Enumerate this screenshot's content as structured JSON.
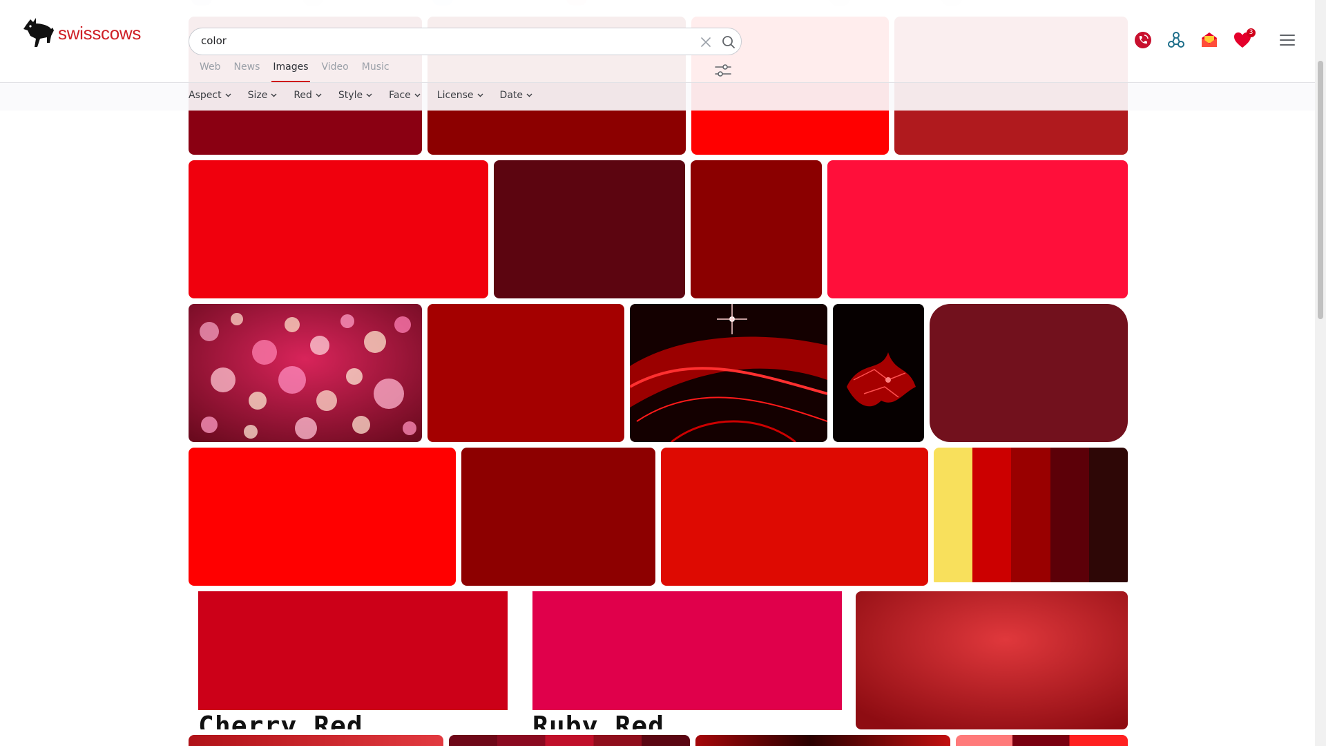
{
  "brand": {
    "name": "swisscows",
    "color": "#cf2027"
  },
  "search": {
    "value": "color",
    "placeholder": ""
  },
  "tabs": [
    {
      "label": "Web",
      "active": false
    },
    {
      "label": "News",
      "active": false
    },
    {
      "label": "Images",
      "active": true
    },
    {
      "label": "Video",
      "active": false
    },
    {
      "label": "Music",
      "active": false
    }
  ],
  "filters": [
    {
      "label": "Aspect"
    },
    {
      "label": "Size"
    },
    {
      "label": "Red"
    },
    {
      "label": "Style"
    },
    {
      "label": "Face"
    },
    {
      "label": "License"
    },
    {
      "label": "Date"
    }
  ],
  "header_icons": [
    {
      "name": "vpn-phone-icon",
      "color": "#c8102e"
    },
    {
      "name": "network-nodes-icon",
      "color": "#1f6f8b"
    },
    {
      "name": "mail-icon",
      "color": "#e4002b"
    },
    {
      "name": "favorites-heart-icon",
      "color": "#e4002b",
      "badge": "3"
    }
  ],
  "colors": {
    "accent": "#d0021b"
  },
  "images": [
    {
      "name": "image-dark-red-1",
      "fill": "#8a0012"
    },
    {
      "name": "image-dark-red-2",
      "fill": "#8c0000"
    },
    {
      "name": "image-bright-red-1",
      "fill": "#ff0000"
    },
    {
      "name": "image-brick-red-1",
      "fill": "#b01a1e"
    },
    {
      "name": "image-red-2",
      "fill": "#f0000d"
    },
    {
      "name": "image-maroon-texture",
      "fill": "#5c0510"
    },
    {
      "name": "image-dark-red-3",
      "fill": "#8b0000"
    },
    {
      "name": "image-crimson-1",
      "fill": "#ff0f3a"
    },
    {
      "name": "image-bokeh",
      "fill": "#b1173a"
    },
    {
      "name": "image-dark-red-4",
      "fill": "#a40000"
    },
    {
      "name": "image-red-swirl",
      "fill": "#1b0000"
    },
    {
      "name": "image-red-fractal",
      "fill": "#080000"
    },
    {
      "name": "image-maroon-2",
      "fill": "#72111d"
    },
    {
      "name": "image-bright-red-2",
      "fill": "#ff0000"
    },
    {
      "name": "image-dark-red-5",
      "fill": "#8d0000"
    },
    {
      "name": "image-red-3",
      "fill": "#de0a02"
    },
    {
      "name": "image-red-palette",
      "fill": "#ffffff",
      "palette": [
        "#f8e05c",
        "#cc0000",
        "#990000",
        "#5c0008",
        "#2e0706"
      ]
    },
    {
      "name": "image-leather-red",
      "fill": "#c41e24"
    },
    {
      "name": "image-red-4",
      "fill": "#b01218"
    },
    {
      "name": "image-palette-2",
      "fill": "#8a0a20"
    },
    {
      "name": "image-red-5",
      "fill": "#a5070a"
    },
    {
      "name": "image-red-6",
      "fill": "#ff5a5a"
    }
  ],
  "swatches": [
    {
      "label": "Cherry Red",
      "color": "#cc0018"
    },
    {
      "label": "Ruby Red",
      "color": "#e0004b"
    }
  ]
}
